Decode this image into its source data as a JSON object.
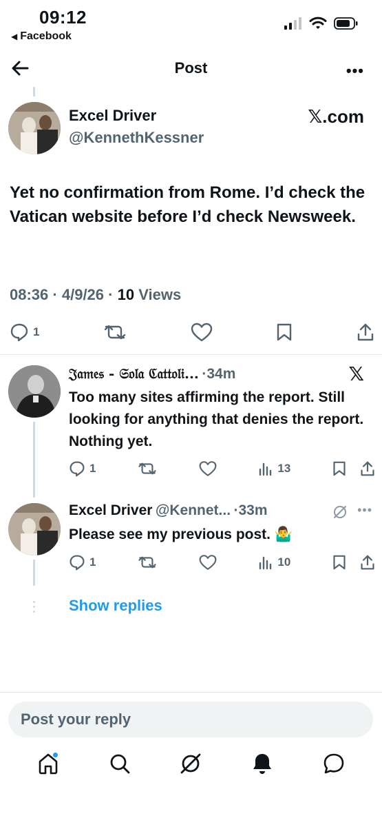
{
  "status_bar": {
    "time": "09:12",
    "back_app": "Facebook",
    "icons": [
      "cellular-signal-icon",
      "wifi-icon",
      "battery-icon"
    ]
  },
  "nav": {
    "title": "Post",
    "icons": [
      "back-arrow-icon",
      "more-options-icon"
    ]
  },
  "main_post": {
    "name": "Excel Driver",
    "handle": "@KennethKessner",
    "badge": "𝕏.com",
    "text": "Yet no confirmation from Rome. I’d check the Vatican website before I’d check Newsweek.",
    "time": "08:36",
    "date": "4/9/26",
    "views_count": "10",
    "views_label": "Views",
    "reply_count": "1",
    "icons": [
      "reply-icon",
      "repost-icon",
      "like-icon",
      "bookmark-icon",
      "share-icon"
    ]
  },
  "replies": [
    {
      "name": "𝔍𝔞𝔪𝔢𝔰 - 𝔖𝔬𝔩𝔞 ℭ𝔞𝔱𝔱𝔬𝔩𝔦...",
      "time": "·34m",
      "badge": "𝕏",
      "text": "Too many sites affirming the report. Still looking for anything that denies the report. Nothing yet.",
      "reply_count": "1",
      "views": "13"
    },
    {
      "name": "Excel Driver",
      "handle": "@Kennet...",
      "time": "·33m",
      "text": "Please see my previous post. 🤷‍♂️",
      "reply_count": "1",
      "views": "10"
    }
  ],
  "show_replies": "Show replies",
  "compose": {
    "placeholder": "Post your reply"
  },
  "tabbar": {
    "icons": [
      "home-icon",
      "search-icon",
      "grok-icon",
      "notifications-icon",
      "messages-icon"
    ]
  },
  "colors": {
    "accent": "#1d9bf0",
    "secondary_text": "#536471",
    "primary_text": "#0f1419"
  }
}
